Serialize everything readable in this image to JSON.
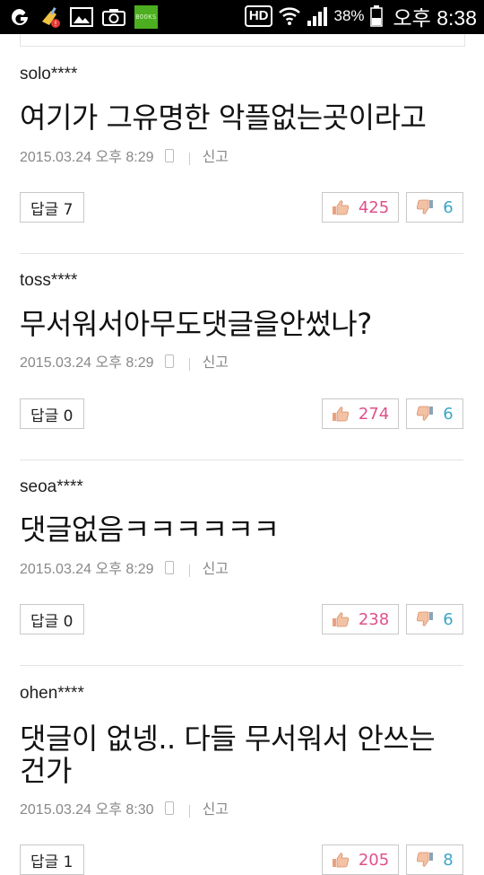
{
  "statusbar": {
    "books_label": "BOOKS",
    "hd_label": "HD",
    "battery_percent": "38%",
    "time": "오후 8:38"
  },
  "comments": [
    {
      "user": "solo****",
      "text": "여기가 그유명한 악플없는곳이라고",
      "date": "2015.03.24 오후 8:29",
      "report": "신고",
      "reply": "답글 7",
      "likes": "425",
      "dislikes": "6"
    },
    {
      "user": "toss****",
      "text": "무서워서아무도댓글을안썼나?",
      "date": "2015.03.24 오후 8:29",
      "report": "신고",
      "reply": "답글 0",
      "likes": "274",
      "dislikes": "6"
    },
    {
      "user": "seoa****",
      "text": "댓글없음ㅋㅋㅋㅋㅋㅋ",
      "date": "2015.03.24 오후 8:29",
      "report": "신고",
      "reply": "답글 0",
      "likes": "238",
      "dislikes": "6"
    },
    {
      "user": "ohen****",
      "text": "댓글이 없넹.. 다들 무서워서 안쓰는 건가",
      "date": "2015.03.24 오후 8:30",
      "report": "신고",
      "reply": "답글 1",
      "likes": "205",
      "dislikes": "8"
    }
  ]
}
